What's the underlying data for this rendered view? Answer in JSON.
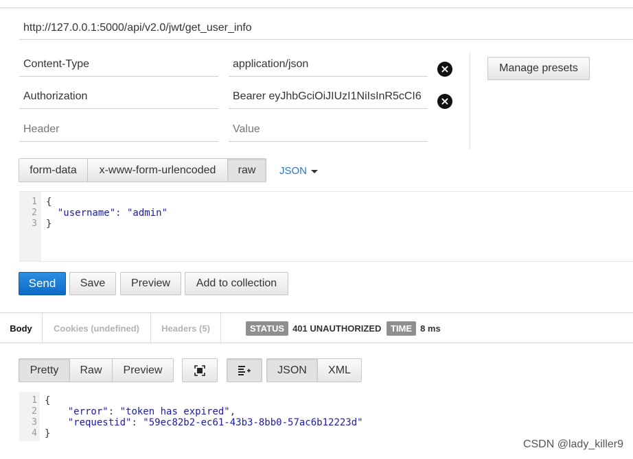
{
  "request": {
    "url": "http://127.0.0.1:5000/api/v2.0/jwt/get_user_info",
    "headers": [
      {
        "key": "Content-Type",
        "value": "application/json"
      },
      {
        "key": "Authorization",
        "value": "Bearer eyJhbGciOiJIUzI1NiIsInR5cCI6"
      }
    ],
    "new_header": {
      "key_placeholder": "Header",
      "value_placeholder": "Value"
    },
    "manage_presets_label": "Manage presets",
    "body_modes": [
      "form-data",
      "x-www-form-urlencoded",
      "raw"
    ],
    "active_body_mode": "raw",
    "raw_format": "JSON",
    "body_lines": [
      "{",
      "  \"username\": \"admin\"",
      "}"
    ],
    "line_numbers": [
      "1",
      "2",
      "3"
    ]
  },
  "actions": {
    "send": "Send",
    "save": "Save",
    "preview": "Preview",
    "add_to_collection": "Add to collection"
  },
  "response": {
    "tabs": [
      "Body",
      "Cookies (undefined)",
      "Headers (5)"
    ],
    "active_tab": "Body",
    "status_label": "STATUS",
    "status_value": "401 UNAUTHORIZED",
    "time_label": "TIME",
    "time_value": "8 ms",
    "view_modes": [
      "Pretty",
      "Raw",
      "Preview"
    ],
    "active_view": "Pretty",
    "formats": [
      "JSON",
      "XML"
    ],
    "active_format": "JSON",
    "line_numbers": [
      "1",
      "2",
      "3",
      "4"
    ],
    "body": {
      "error_key": "\"error\"",
      "error_value": "\"token has expired\"",
      "requestid_key": "\"requestid\"",
      "requestid_value": "\"59ec82b2-ec61-43b3-8bb0-57ac6b12223d\""
    }
  },
  "watermark": "CSDN @lady_killer9",
  "colors": {
    "send_button": "#1474d4",
    "link": "#2a76c6",
    "status_badge": "#8f8f8f"
  }
}
